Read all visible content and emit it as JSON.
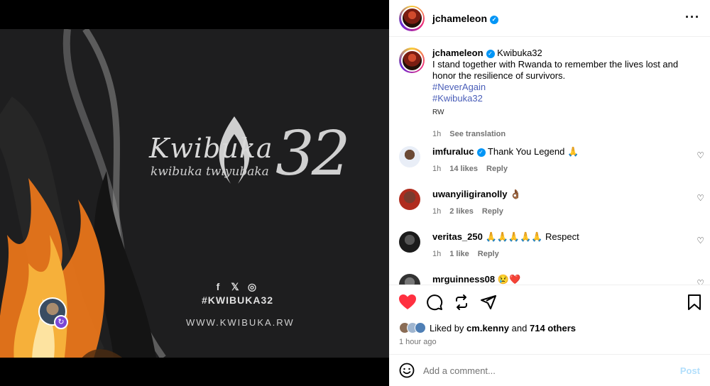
{
  "post": {
    "username": "jchameleon",
    "verified": true,
    "more_icon": "more-horizontal-icon"
  },
  "media": {
    "logo_title": "Kwibuka",
    "logo_subtitle": "kwibuka twiyubaka",
    "logo_number": "32",
    "hashtag": "#KWIBUKA32",
    "website": "WWW.KWIBUKA.RW",
    "social_icons": [
      "facebook-icon",
      "x-icon",
      "instagram-icon"
    ]
  },
  "caption": {
    "username": "jchameleon",
    "title": "Kwibuka32",
    "text": "I stand together with Rwanda to remember the lives lost and honor the resilience of survivors.",
    "hashtags": [
      "#NeverAgain",
      "#Kwibuka32"
    ],
    "location_tag": "RW",
    "time": "1h",
    "see_translation": "See translation"
  },
  "comments": [
    {
      "username": "imfuraluc",
      "verified": true,
      "text": "Thank You Legend 🙏",
      "time": "1h",
      "likes": "14 likes",
      "reply": "Reply"
    },
    {
      "username": "uwanyiligiranolly",
      "verified": false,
      "text": "👌🏾",
      "time": "1h",
      "likes": "2 likes",
      "reply": "Reply"
    },
    {
      "username": "veritas_250",
      "verified": false,
      "text": "🙏🙏🙏🙏🙏 Respect",
      "time": "1h",
      "likes": "1 like",
      "reply": "Reply"
    },
    {
      "username": "mrguinness08",
      "verified": false,
      "text": "😢❤️",
      "time": "",
      "likes": "",
      "reply": ""
    }
  ],
  "actions": {
    "liked": true,
    "liked_by_prefix": "Liked by",
    "liked_by_user": "cm.kenny",
    "liked_by_and": "and",
    "others": "714 others",
    "time_ago": "1 hour ago"
  },
  "comment_box": {
    "placeholder": "Add a comment...",
    "post_label": "Post"
  },
  "colors": {
    "like_red": "#ff3040",
    "verified_blue": "#0095f6",
    "hashtag_blue": "#4a5eb8",
    "post_disabled": "#b2dffc"
  }
}
